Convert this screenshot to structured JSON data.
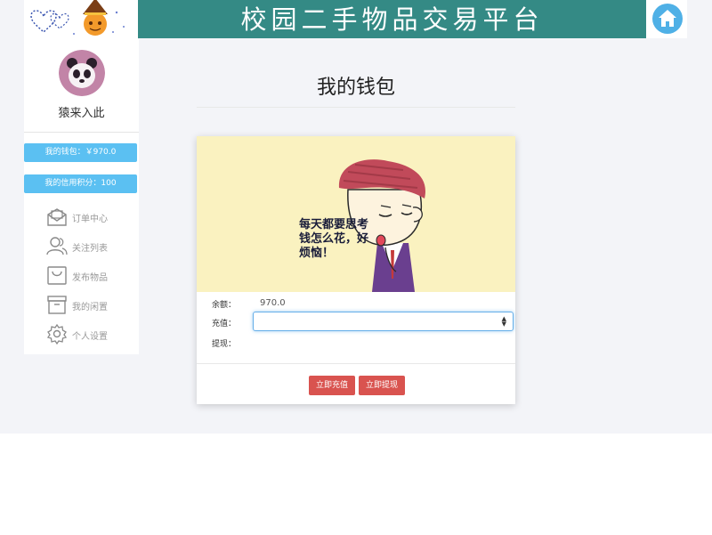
{
  "header": {
    "title": "校园二手物品交易平台",
    "home_icon": "home-icon",
    "banner_color": "#348a85"
  },
  "sidebar": {
    "username": "猿来入此",
    "avatar": "panda-avatar",
    "wallet_label": "我的钱包：￥970.0",
    "credit_label": "我的信用积分：100",
    "nav": [
      {
        "icon": "envelope-icon",
        "label": "订单中心"
      },
      {
        "icon": "users-icon",
        "label": "关注列表"
      },
      {
        "icon": "bag-icon",
        "label": "发布物品"
      },
      {
        "icon": "archive-icon",
        "label": "我的闲置"
      },
      {
        "icon": "gear-icon",
        "label": "个人设置"
      }
    ]
  },
  "main": {
    "title": "我的钱包",
    "illustration_caption": "每天都要思考钱怎么花，好烦恼！",
    "form": {
      "balance_label": "余额：",
      "balance_value": "970.0",
      "recharge_label": "充值：",
      "recharge_value": "",
      "withdraw_label": "提现："
    },
    "buttons": {
      "recharge": "立即充值",
      "withdraw": "立即提现"
    }
  },
  "colors": {
    "accent": "#5bc0f2",
    "danger": "#d9534f",
    "illustration_bg": "#faf2c0"
  }
}
